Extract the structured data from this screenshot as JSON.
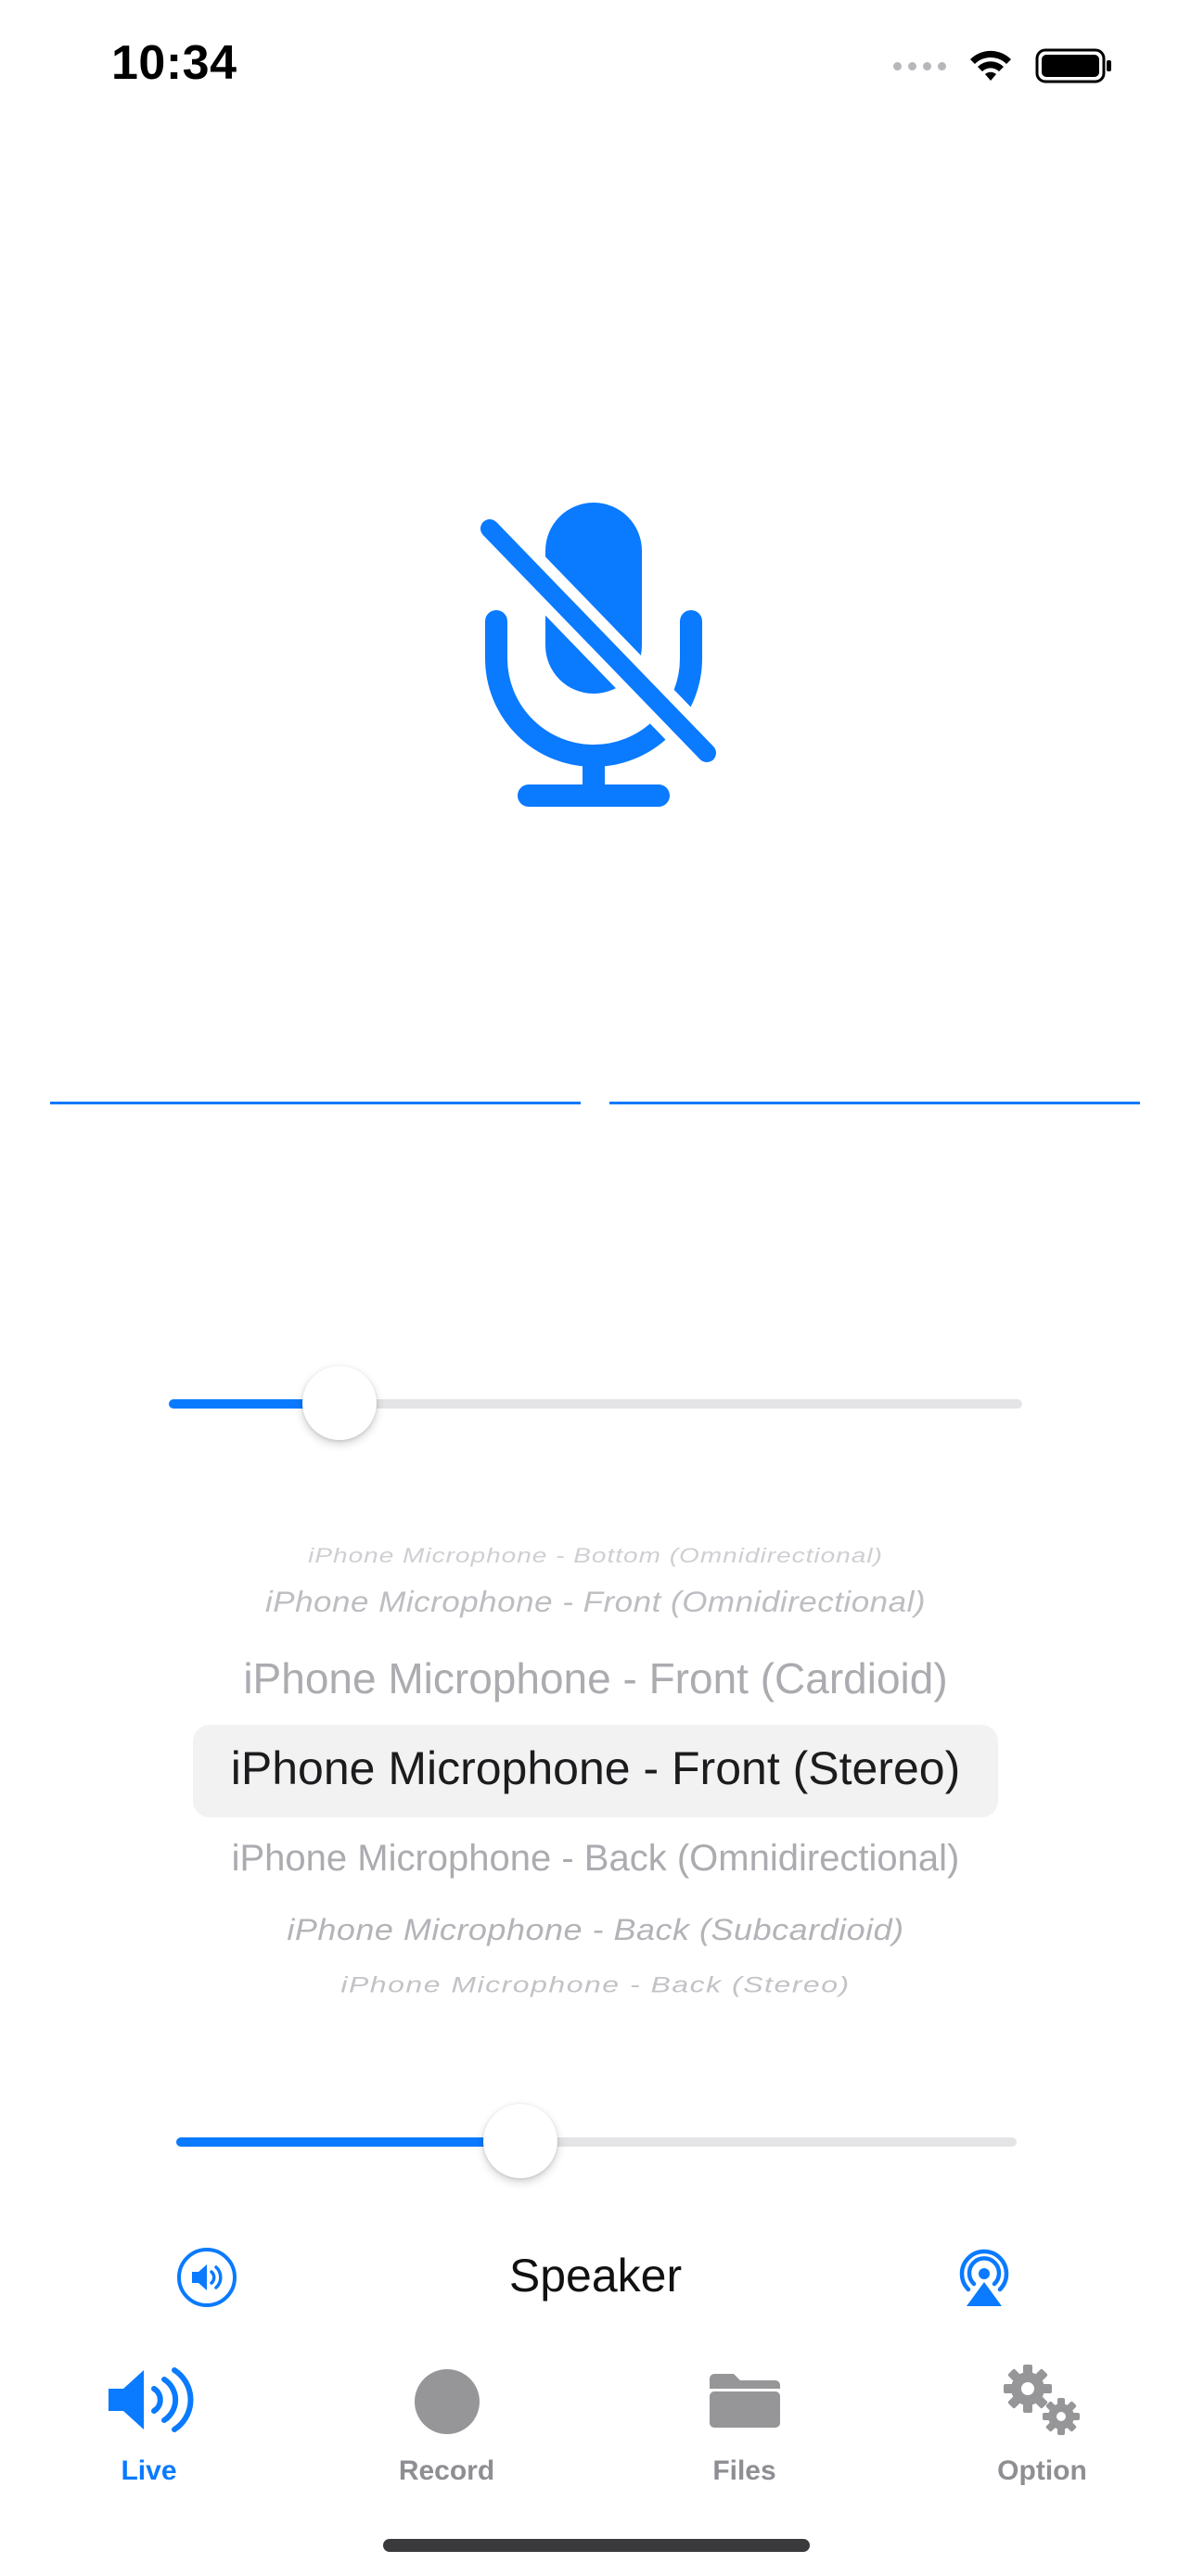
{
  "status_bar": {
    "time": "10:34",
    "icons": [
      "signal-dots-icon",
      "wifi-icon",
      "battery-icon"
    ]
  },
  "mic": {
    "state": "muted",
    "icon": "mic-slash-icon",
    "color": "#0a7aff"
  },
  "level_meters": {
    "left_level": 1.0,
    "right_level": 1.0
  },
  "gain_slider": {
    "value": 0.2
  },
  "mic_picker": {
    "options": [
      "iPhone Microphone - Bottom (Omnidirectional)",
      "iPhone Microphone - Front (Omnidirectional)",
      "iPhone Microphone - Front (Cardioid)",
      "iPhone Microphone - Front (Stereo)",
      "iPhone Microphone - Back (Omnidirectional)",
      "iPhone Microphone - Back (Subcardioid)",
      "iPhone Microphone - Back (Stereo)"
    ],
    "selected_index": 3
  },
  "volume_slider": {
    "value": 0.41
  },
  "output": {
    "label": "Speaker",
    "speaker_icon": "speaker-icon",
    "airplay_icon": "airplay-icon"
  },
  "tab_bar": {
    "tabs": [
      {
        "label": "Live",
        "icon": "speaker-wave-icon",
        "active": true
      },
      {
        "label": "Record",
        "icon": "record-icon",
        "active": false
      },
      {
        "label": "Files",
        "icon": "folder-icon",
        "active": false
      },
      {
        "label": "Option",
        "icon": "gears-icon",
        "active": false
      }
    ]
  },
  "colors": {
    "accent": "#0a7aff",
    "inactive": "#8e8e93"
  }
}
